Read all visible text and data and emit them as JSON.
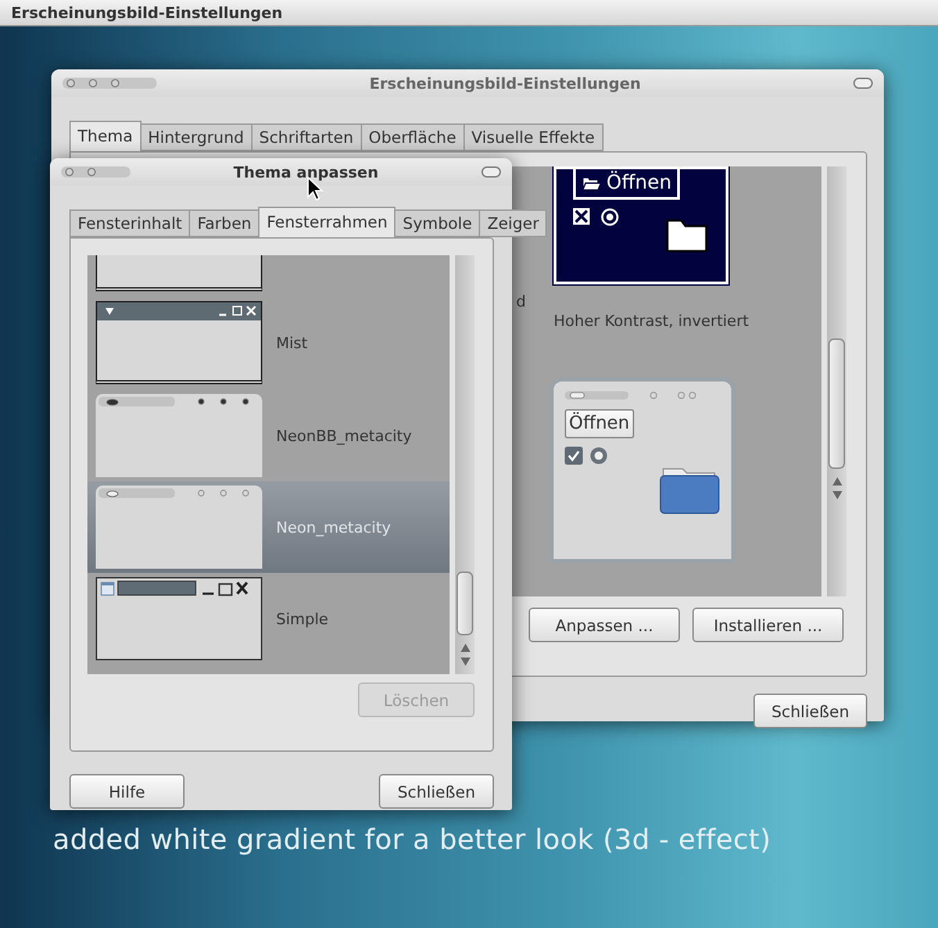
{
  "desktop": {
    "top_bar_title": "Erscheinungsbild-Einstellungen",
    "caption": "added white gradient for a better look (3d - effect)"
  },
  "main_window": {
    "title": "Erscheinungsbild-Einstellungen",
    "tabs": [
      {
        "label": "Thema",
        "selected": true
      },
      {
        "label": "Hintergrund",
        "selected": false
      },
      {
        "label": "Schriftarten",
        "selected": false
      },
      {
        "label": "Oberfläche",
        "selected": false
      },
      {
        "label": "Visuelle Effekte",
        "selected": false
      }
    ],
    "themes": [
      {
        "kind": "covered",
        "name": "d"
      },
      {
        "kind": "contrast-inverse",
        "name": "Hoher Kontrast, invertiert",
        "button": "Öffnen"
      },
      {
        "kind": "covered"
      },
      {
        "kind": "light",
        "button": "Öffnen"
      }
    ],
    "buttons": [
      {
        "label": "Anpassen ..."
      },
      {
        "label": "Installieren ..."
      }
    ],
    "close": {
      "label": "Schließen"
    }
  },
  "dialog": {
    "title": "Thema anpassen",
    "tabs": [
      {
        "label": "Fensterinhalt",
        "selected": false
      },
      {
        "label": "Farben",
        "selected": false
      },
      {
        "label": "Fensterrahmen",
        "selected": true
      },
      {
        "label": "Symbole",
        "selected": false
      },
      {
        "label": "Zeiger",
        "selected": false
      }
    ],
    "frames": [
      {
        "kind": "partial",
        "selected": false
      },
      {
        "kind": "mist",
        "name": "Mist",
        "selected": false
      },
      {
        "kind": "neonbb",
        "name": "NeonBB_metacity",
        "selected": false
      },
      {
        "kind": "neon",
        "name": "Neon_metacity",
        "selected": true
      },
      {
        "kind": "simple",
        "name": "Simple",
        "selected": false
      }
    ],
    "delete": {
      "label": "Löschen",
      "disabled": true
    },
    "help": {
      "label": "Hilfe"
    },
    "close": {
      "label": "Schließen"
    }
  }
}
